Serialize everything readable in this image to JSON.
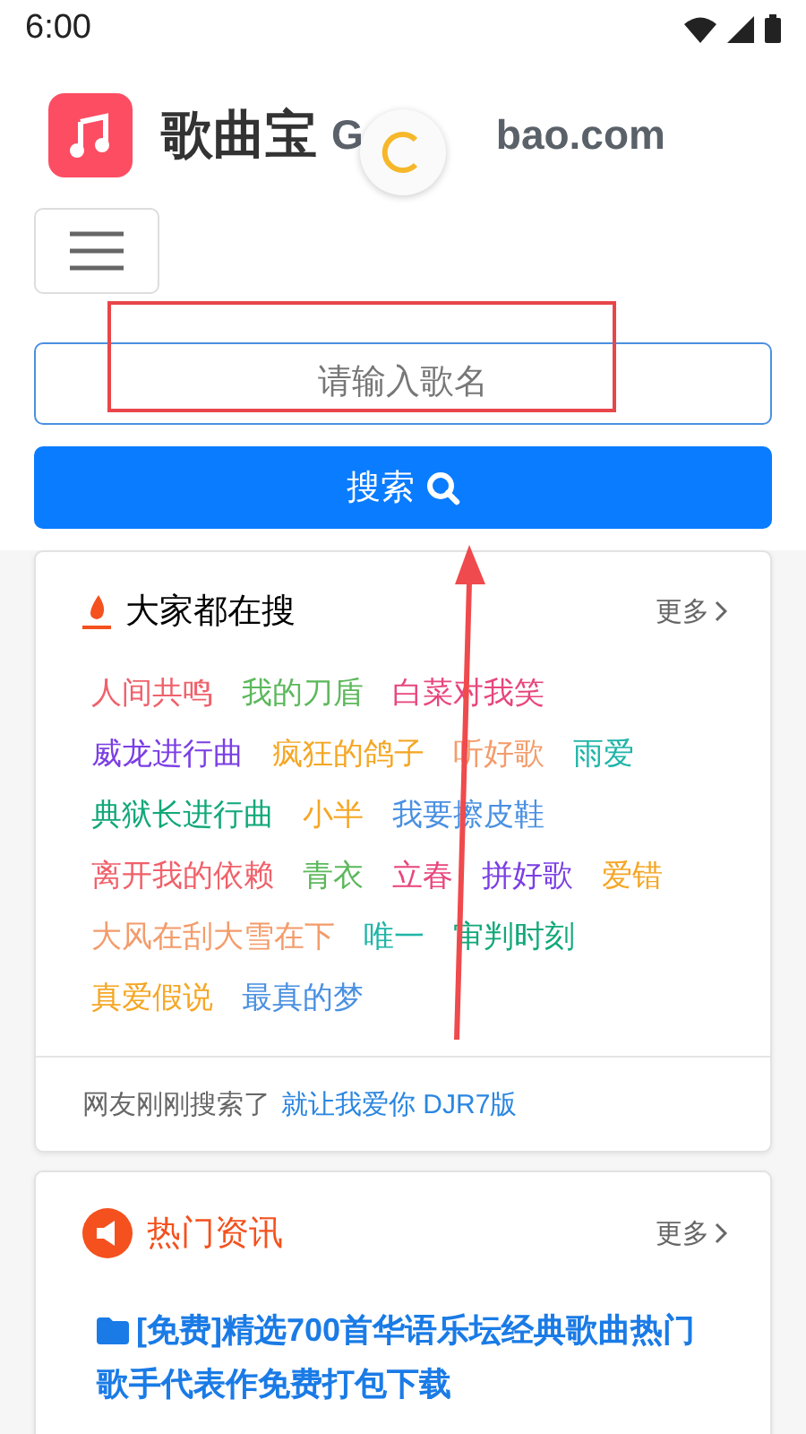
{
  "status_bar": {
    "time": "6:00"
  },
  "header": {
    "title": "歌曲宝",
    "domain_start": "G",
    "domain_end": "bao.com"
  },
  "search": {
    "placeholder": "请输入歌名",
    "button": "搜索"
  },
  "hot_searches": {
    "title": "大家都在搜",
    "more": "更多",
    "tags": [
      {
        "text": "人间共鸣",
        "color": "#f0616b"
      },
      {
        "text": "我的刀盾",
        "color": "#5cb85c"
      },
      {
        "text": "白菜对我笑",
        "color": "#e8467c"
      },
      {
        "text": "威龙进行曲",
        "color": "#7b3fe4"
      },
      {
        "text": "疯狂的鸽子",
        "color": "#f5a623"
      },
      {
        "text": "听好歌",
        "color": "#f39c6b"
      },
      {
        "text": "雨爱",
        "color": "#1fb5a8"
      },
      {
        "text": "典狱长进行曲",
        "color": "#12a879"
      },
      {
        "text": "小半",
        "color": "#f5a623"
      },
      {
        "text": "我要擦皮鞋",
        "color": "#4a90e2"
      },
      {
        "text": "离开我的依赖",
        "color": "#f0616b"
      },
      {
        "text": "青衣",
        "color": "#5cb85c"
      },
      {
        "text": "立春",
        "color": "#e8467c"
      },
      {
        "text": "拼好歌",
        "color": "#7b3fe4"
      },
      {
        "text": "爱错",
        "color": "#f5a623"
      },
      {
        "text": "大风在刮大雪在下",
        "color": "#f39c6b"
      },
      {
        "text": "唯一",
        "color": "#1fb5a8"
      },
      {
        "text": "审判时刻",
        "color": "#12a879"
      },
      {
        "text": "真爱假说",
        "color": "#f5a623"
      },
      {
        "text": "最真的梦",
        "color": "#4a90e2"
      }
    ],
    "recent_label": "网友刚刚搜索了",
    "recent_link": "就让我爱你 DJR7版"
  },
  "news": {
    "title": "热门资讯",
    "more": "更多",
    "items": [
      {
        "text": "[免费]精选700首华语乐坛经典歌曲热门歌手代表作免费打包下载"
      }
    ]
  }
}
